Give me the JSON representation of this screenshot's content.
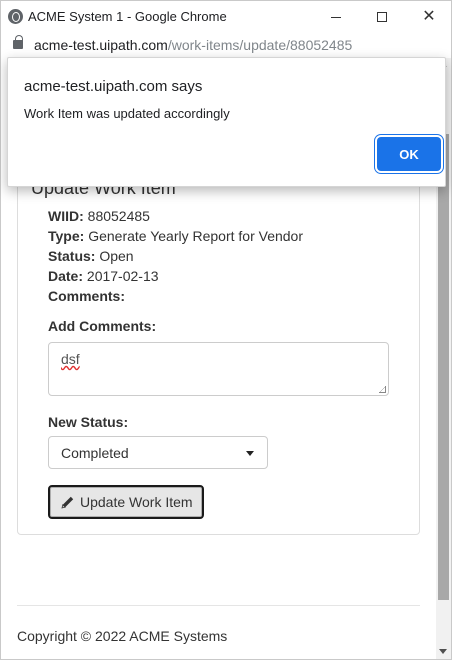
{
  "window": {
    "title": "ACME System 1 - Google Chrome",
    "close_glyph": "✕"
  },
  "address": {
    "host": "acme-test.uipath.com",
    "path": "/work-items/update/88052485"
  },
  "page": {
    "panel_title": "Update Work Item",
    "fields": {
      "wiid_label": "WIID:",
      "wiid_value": "88052485",
      "type_label": "Type:",
      "type_value": "Generate Yearly Report for Vendor",
      "status_label": "Status:",
      "status_value": "Open",
      "date_label": "Date:",
      "date_value": "2017-02-13",
      "comments_label": "Comments:"
    },
    "add_comments_label": "Add Comments:",
    "add_comments_value": "dsf",
    "new_status_label": "New Status:",
    "new_status_value": "Completed",
    "update_button": "Update Work Item",
    "footer": "Copyright © 2022 ACME Systems"
  },
  "dialog": {
    "title": "acme-test.uipath.com says",
    "message": "Work Item was updated accordingly",
    "ok_label": "OK",
    "accent": "#1a73e8"
  },
  "icons": {
    "browser": "globe-icon",
    "lock": "lock-icon",
    "pencil": "pencil-icon",
    "caret": "caret-down-icon"
  }
}
